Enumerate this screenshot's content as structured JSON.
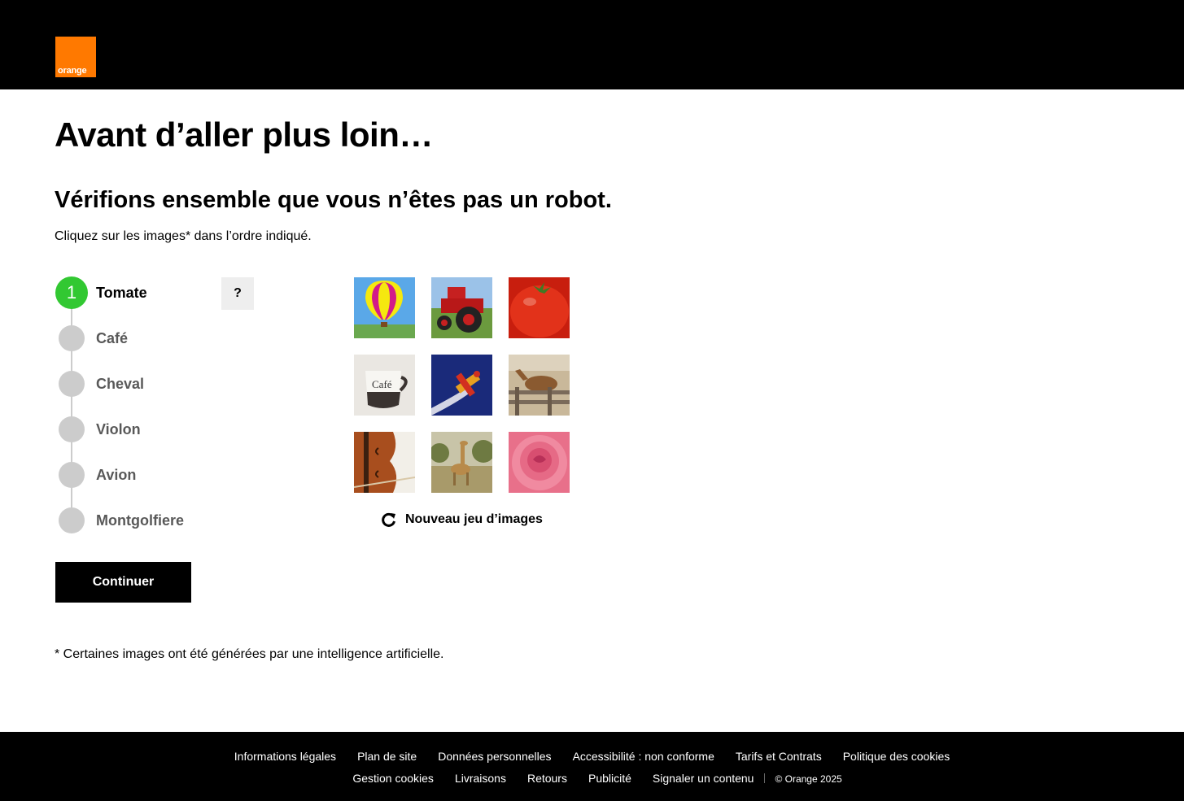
{
  "header": {
    "logo_text": "orange",
    "brand_color": "#ff7900"
  },
  "main": {
    "title": "Avant d’aller plus loin…",
    "subtitle": "Vérifions ensemble que vous n’êtes pas un robot.",
    "instruction": "Cliquez sur les images* dans l’ordre indiqué.",
    "help_label": "?",
    "steps": [
      {
        "number": "1",
        "label": "Tomate",
        "active": true
      },
      {
        "label": "Café",
        "active": false
      },
      {
        "label": "Cheval",
        "active": false
      },
      {
        "label": "Violon",
        "active": false
      },
      {
        "label": "Avion",
        "active": false
      },
      {
        "label": "Montgolfiere",
        "active": false
      }
    ],
    "images": [
      {
        "subject": "montgolfiere"
      },
      {
        "subject": "tracteur"
      },
      {
        "subject": "tomate"
      },
      {
        "subject": "cafe",
        "caption": "Café"
      },
      {
        "subject": "avion"
      },
      {
        "subject": "cheval"
      },
      {
        "subject": "violon"
      },
      {
        "subject": "girafe"
      },
      {
        "subject": "rose"
      }
    ],
    "refresh_label": "Nouveau jeu d’images",
    "continue_label": "Continuer",
    "footnote": "* Certaines images ont été générées par une intelligence artificielle.",
    "active_color": "#32c832"
  },
  "footer": {
    "row1": [
      "Informations légales",
      "Plan de site",
      "Données personnelles",
      "Accessibilité : non conforme",
      "Tarifs et Contrats",
      "Politique des cookies"
    ],
    "row2": [
      "Gestion cookies",
      "Livraisons",
      "Retours",
      "Publicité",
      "Signaler un contenu"
    ],
    "copyright": "© Orange 2025"
  }
}
